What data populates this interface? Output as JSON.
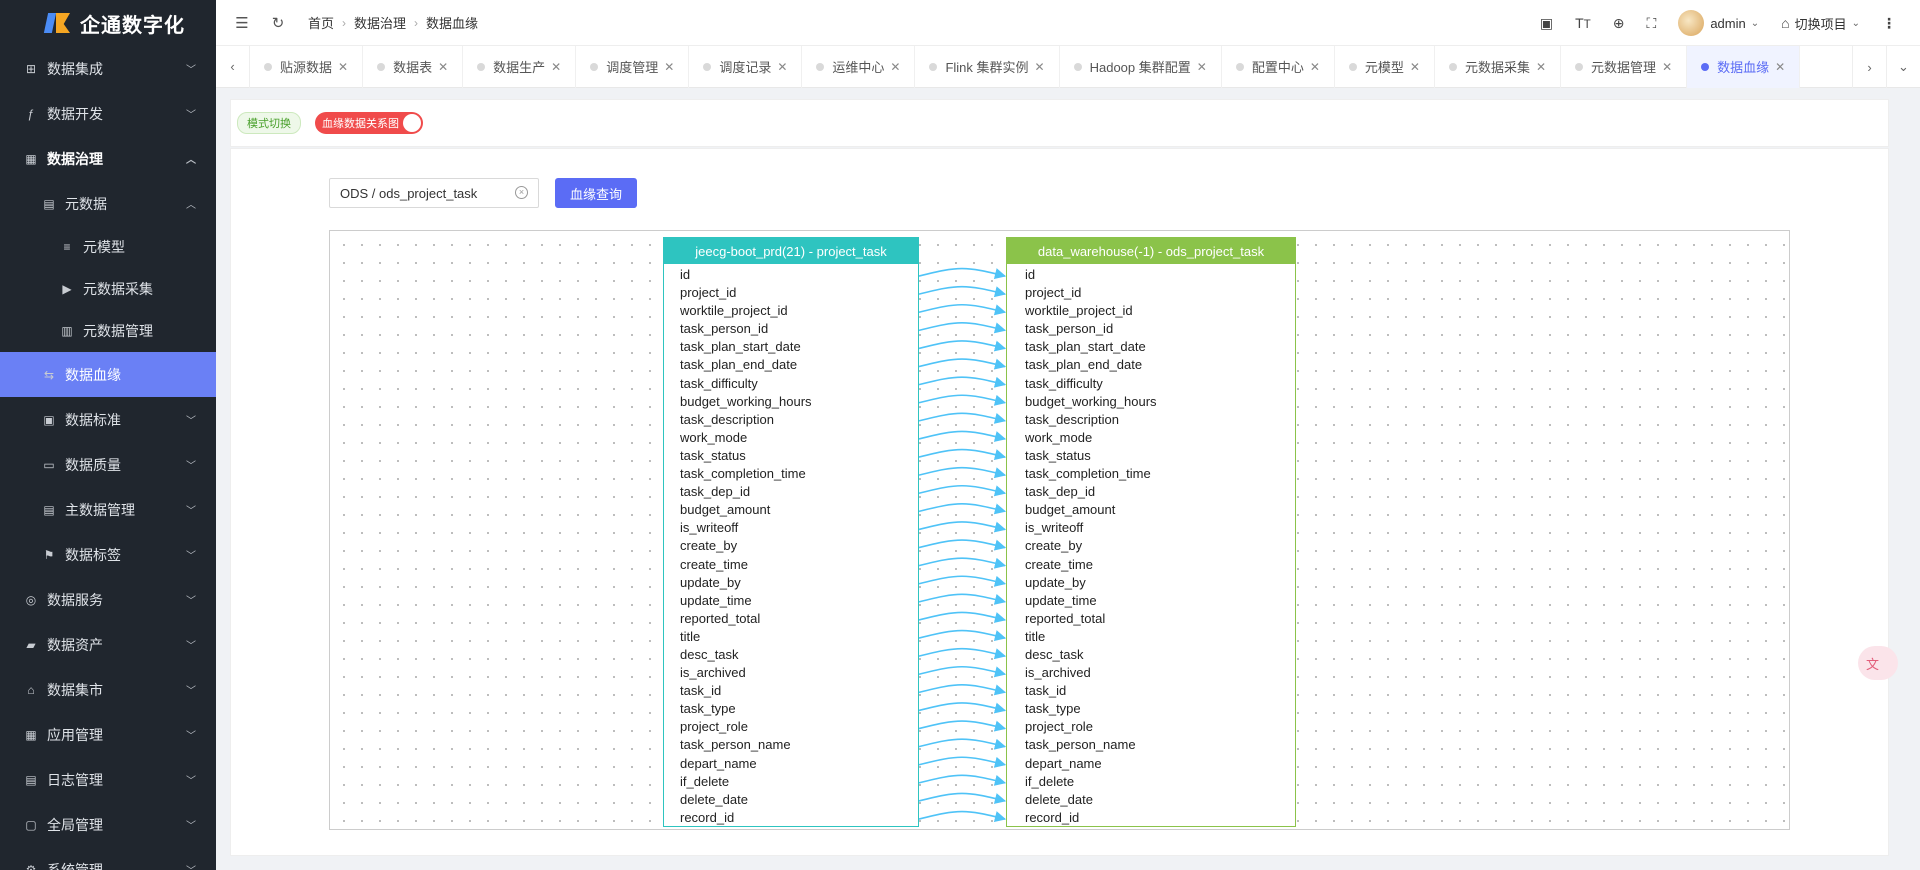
{
  "app": {
    "name": "企通数字化"
  },
  "sidebar": {
    "items": [
      {
        "label": "数据集成",
        "icon": "integration-icon",
        "level": 1
      },
      {
        "label": "数据开发",
        "icon": "fx-icon",
        "level": 1
      },
      {
        "label": "数据治理",
        "icon": "grid-icon",
        "level": 1,
        "expanded": true
      },
      {
        "label": "元数据",
        "icon": "doc-icon",
        "level": 2,
        "expanded": true
      },
      {
        "label": "元模型",
        "icon": "list-icon",
        "level": 3
      },
      {
        "label": "元数据采集",
        "icon": "collect-icon",
        "level": 3
      },
      {
        "label": "元数据管理",
        "icon": "manage-icon",
        "level": 3
      },
      {
        "label": "数据血缘",
        "icon": "lineage-icon",
        "level": 2,
        "active": true
      },
      {
        "label": "数据标准",
        "icon": "standard-icon",
        "level": 2
      },
      {
        "label": "数据质量",
        "icon": "quality-icon",
        "level": 2
      },
      {
        "label": "主数据管理",
        "icon": "master-icon",
        "level": 2
      },
      {
        "label": "数据标签",
        "icon": "tag-icon",
        "level": 2
      },
      {
        "label": "数据服务",
        "icon": "service-icon",
        "level": 1
      },
      {
        "label": "数据资产",
        "icon": "asset-icon",
        "level": 1
      },
      {
        "label": "数据集市",
        "icon": "market-icon",
        "level": 1
      },
      {
        "label": "应用管理",
        "icon": "apps-icon",
        "level": 1
      },
      {
        "label": "日志管理",
        "icon": "log-icon",
        "level": 1
      },
      {
        "label": "全局管理",
        "icon": "global-icon",
        "level": 1
      },
      {
        "label": "系统管理",
        "icon": "system-icon",
        "level": 1
      }
    ]
  },
  "header": {
    "breadcrumb": [
      "首页",
      "数据治理",
      "数据血缘"
    ],
    "user": "admin",
    "switch_project": "切换项目"
  },
  "tabs": [
    {
      "label": "贴源数据"
    },
    {
      "label": "数据表"
    },
    {
      "label": "数据生产"
    },
    {
      "label": "调度管理"
    },
    {
      "label": "调度记录"
    },
    {
      "label": "运维中心"
    },
    {
      "label": "Flink 集群实例"
    },
    {
      "label": "Hadoop 集群配置"
    },
    {
      "label": "配置中心"
    },
    {
      "label": "元模型"
    },
    {
      "label": "元数据采集"
    },
    {
      "label": "元数据管理"
    },
    {
      "label": "数据血缘",
      "active": true
    }
  ],
  "toolbar": {
    "mode_label": "模式切换",
    "switch_label": "血缘数据关系图"
  },
  "search": {
    "value": "ODS / ods_project_task",
    "button": "血缘查询"
  },
  "lineage": {
    "source": {
      "title": "jeecg-boot_prd(21) - project_task",
      "color": "#2ec4c0"
    },
    "target": {
      "title": "data_warehouse(-1) - ods_project_task",
      "color": "#8bc34a"
    },
    "fields": [
      "id",
      "project_id",
      "worktile_project_id",
      "task_person_id",
      "task_plan_start_date",
      "task_plan_end_date",
      "task_difficulty",
      "budget_working_hours",
      "task_description",
      "work_mode",
      "task_status",
      "task_completion_time",
      "task_dep_id",
      "budget_amount",
      "is_writeoff",
      "create_by",
      "create_time",
      "update_by",
      "update_time",
      "reported_total",
      "title",
      "desc_task",
      "is_archived",
      "task_id",
      "task_type",
      "project_role",
      "task_person_name",
      "depart_name",
      "if_delete",
      "delete_date",
      "record_id"
    ],
    "edge_color": "#4fc3f7"
  }
}
